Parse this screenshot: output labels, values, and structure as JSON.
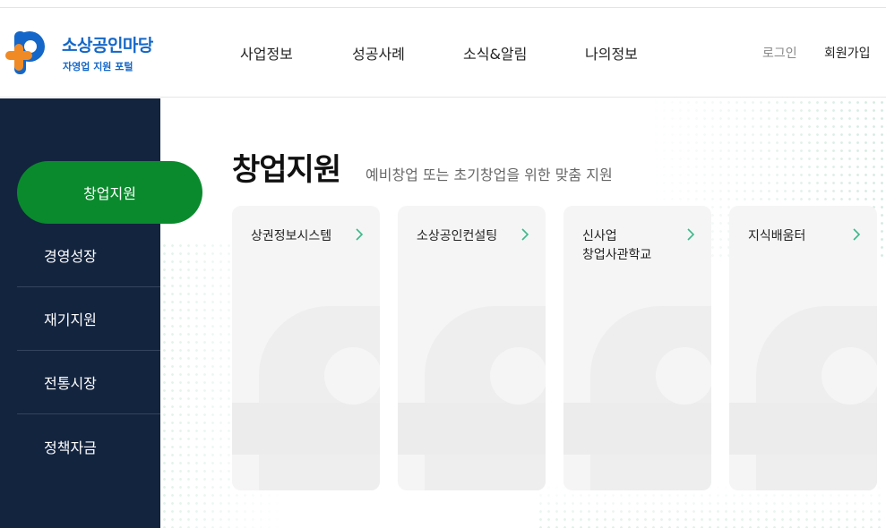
{
  "logo": {
    "title": "소상공인마당",
    "subtitle": "자영업 지원 포털",
    "icon": "p-plus-logo-icon"
  },
  "nav": [
    "사업정보",
    "성공사례",
    "소식&알림",
    "나의정보"
  ],
  "util": {
    "login": "로그인",
    "join": "회원가입"
  },
  "sidebar": {
    "items": [
      "창업지원",
      "경영성장",
      "재기지원",
      "전통시장",
      "정책자금"
    ],
    "active_index": 0
  },
  "main": {
    "title": "창업지원",
    "description": "예비창업 또는 초기창업을 위한 맞춤 지원",
    "cards": [
      {
        "label": "상권정보시스템",
        "icon": "chevron-right-icon"
      },
      {
        "label": "소상공인컨설팅",
        "icon": "chevron-right-icon"
      },
      {
        "label": "신사업\n창업사관학교",
        "icon": "chevron-right-icon"
      },
      {
        "label": "지식배움터",
        "icon": "chevron-right-icon"
      }
    ]
  },
  "colors": {
    "brand_blue": "#1467c8",
    "brand_orange": "#f08a24",
    "sidebar_bg": "#13243f",
    "active_green": "#0a8a2d",
    "chevron_green": "#3cb88a",
    "card_bg": "#f5f5f5"
  }
}
